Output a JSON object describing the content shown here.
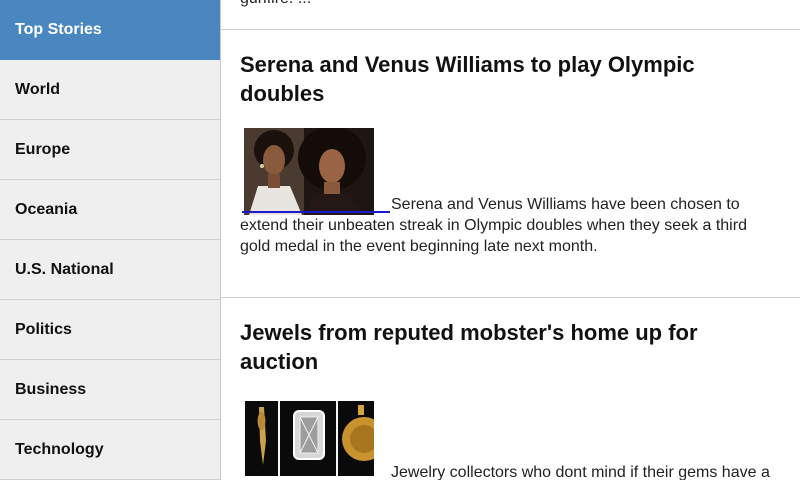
{
  "sidebar": {
    "items": [
      {
        "label": "Top Stories",
        "active": true
      },
      {
        "label": "World"
      },
      {
        "label": "Europe"
      },
      {
        "label": "Oceania"
      },
      {
        "label": "U.S. National"
      },
      {
        "label": "Politics"
      },
      {
        "label": "Business"
      },
      {
        "label": "Technology"
      }
    ]
  },
  "articles": {
    "previous_tail": "gunfire. ...",
    "items": [
      {
        "headline_line1": "Serena and Venus Williams to play Olympic",
        "headline_line2": "doubles",
        "body_line1": "Serena and Venus Williams have been chosen to",
        "body_line2": "extend their unbeaten streak in Olympic doubles when they seek a third",
        "body_line3": "gold medal in the event beginning late next month."
      },
      {
        "headline_line1": "Jewels from reputed mobster's home up for",
        "headline_line2": "auction",
        "body_line1": "Jewelry collectors who dont mind if their gems have a"
      }
    ]
  },
  "colors": {
    "active_nav": "#4a86bf",
    "nav_bg": "#efefef",
    "link": "#1a1acc"
  }
}
